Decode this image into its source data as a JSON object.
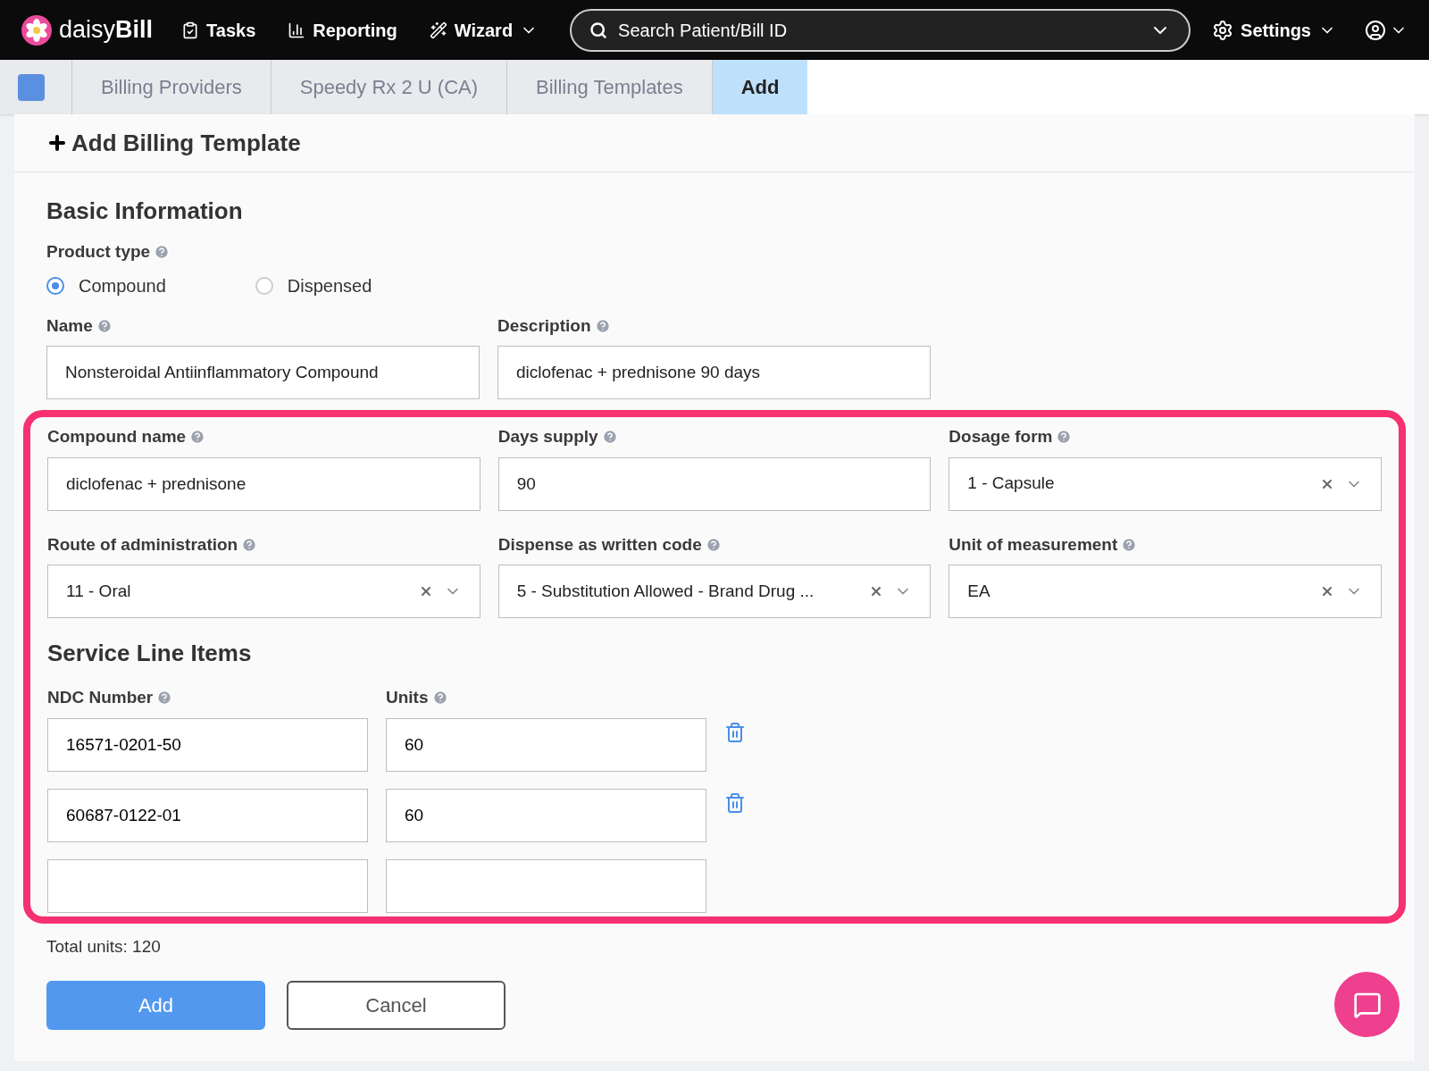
{
  "nav": {
    "logo": "daisy**Bill**",
    "items": [
      {
        "label": "Tasks",
        "kind": "tasks",
        "dropdown": false
      },
      {
        "label": "Reporting",
        "kind": "reporting",
        "dropdown": false
      },
      {
        "label": "Wizard",
        "kind": "wizard",
        "dropdown": true
      }
    ],
    "search": {
      "placeholder": "Search Patient/Bill ID"
    },
    "settings": "Settings"
  },
  "breadcrumbs": [
    {
      "label": "Billing Providers",
      "selected": false
    },
    {
      "label": "Speedy Rx 2 U (CA)",
      "selected": false
    },
    {
      "label": "Billing Templates",
      "selected": false
    },
    {
      "label": "Add",
      "selected": true
    }
  ],
  "title": "Add Billing Template",
  "basic": {
    "heading": "Basic Information",
    "product_type": {
      "label": "Product type",
      "options": [
        {
          "label": "Compound",
          "selected": true
        },
        {
          "label": "Dispensed",
          "selected": false
        }
      ]
    },
    "fields": [
      {
        "label": "Name",
        "kind": "text",
        "value": "Nonsteroidal Antiinflammatory Compound"
      },
      {
        "label": "Description",
        "kind": "text",
        "value": "diclofenac + prednisone 90 days"
      }
    ]
  },
  "compound_fields": [
    {
      "label": "Compound name",
      "kind": "text",
      "value": "diclofenac + prednisone"
    },
    {
      "label": "Days supply",
      "kind": "text",
      "value": "90"
    },
    {
      "label": "Dosage form",
      "kind": "select",
      "value": "1 - Capsule"
    },
    {
      "label": "Route of administration",
      "kind": "select",
      "value": "11 - Oral"
    },
    {
      "label": "Dispense as written code",
      "kind": "select",
      "value": "5 - Substitution Allowed - Brand Drug ..."
    },
    {
      "label": "Unit of measurement",
      "kind": "select",
      "value": "EA"
    }
  ],
  "service_lines": {
    "heading": "Service Line Items",
    "columns": [
      "NDC Number",
      "Units"
    ],
    "rows": [
      {
        "ndc": "16571-0201-50",
        "units": "60",
        "removable": true
      },
      {
        "ndc": "60687-0122-01",
        "units": "60",
        "removable": true
      },
      {
        "removable": false
      }
    ]
  },
  "total": "Total units: 120",
  "buttons": [
    {
      "label": "Add",
      "kind": "primary"
    },
    {
      "label": "Cancel",
      "kind": "secondary"
    }
  ]
}
